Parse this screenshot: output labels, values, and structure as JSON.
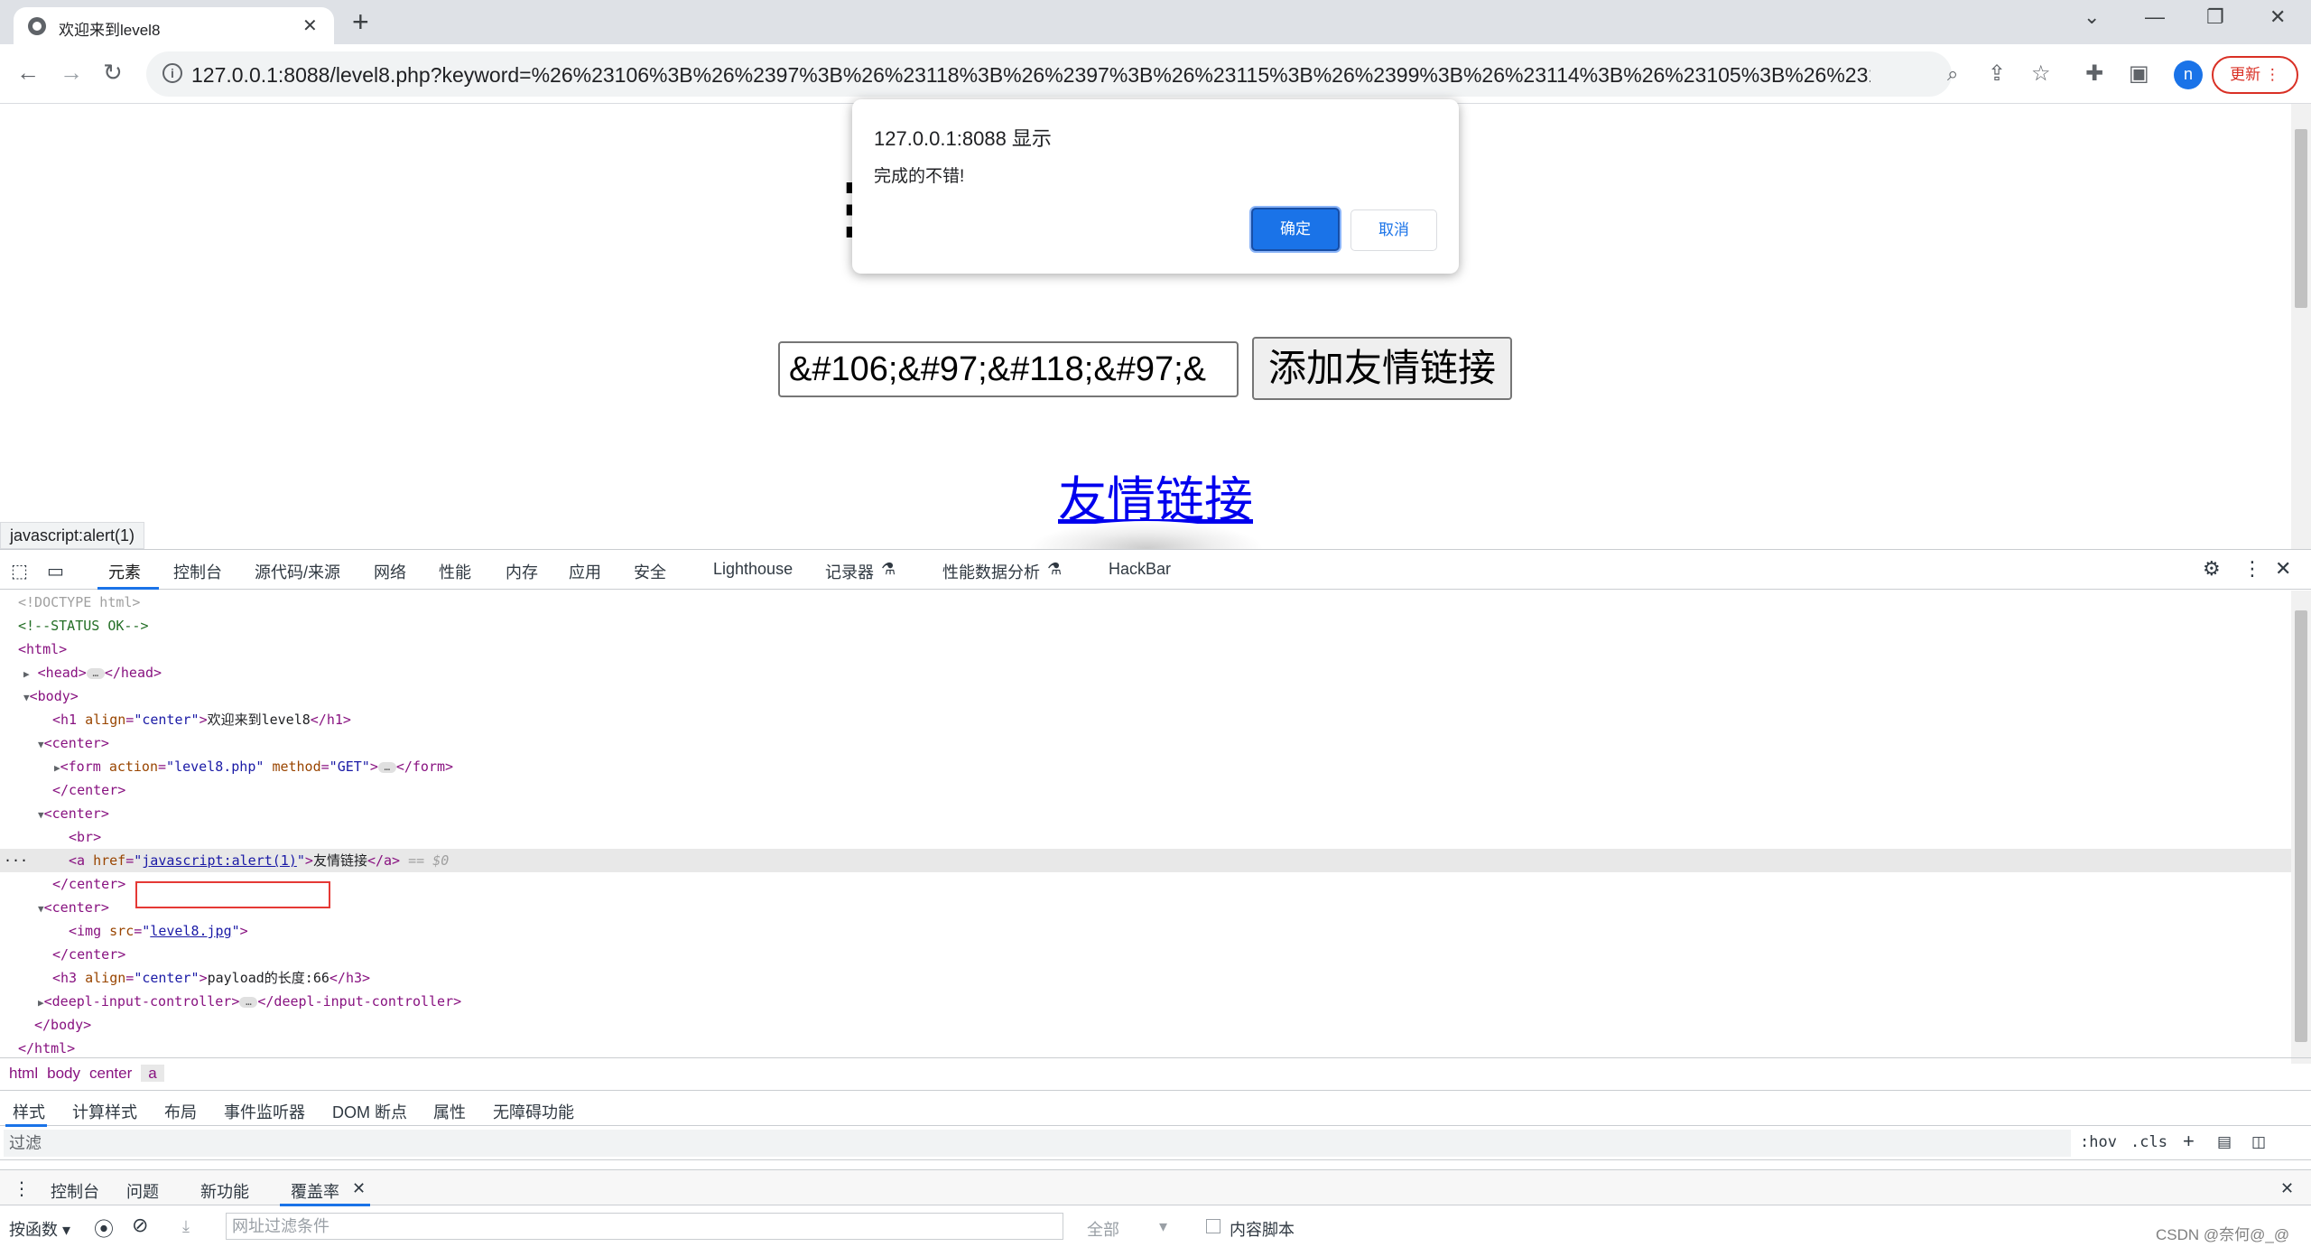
{
  "browser": {
    "tab_title": "欢迎来到level8",
    "url": "127.0.0.1:8088/level8.php?keyword=%26%23106%3B%26%2397%3B%26%23118%3B%26%2397%3B%26%23115%3B%26%2399%3B%26%23114%3B%26%23105%3B%26%23112%3B%26%...",
    "profile_initial": "n",
    "update_label": "更新",
    "icons": [
      "back-icon",
      "forward-icon",
      "reload-icon",
      "info-icon",
      "zoom-icon",
      "share-icon",
      "star-icon",
      "extensions-icon",
      "sidepanel-icon",
      "menu-icon"
    ]
  },
  "page": {
    "keyword_input_value": "&#106;&#97;&#118;&#97;&",
    "submit_label": "添加友情链接",
    "friend_link_text": "友情链接",
    "status_bar_url": "javascript:alert(1)"
  },
  "alert": {
    "origin": "127.0.0.1:8088 显示",
    "message": "完成的不错!",
    "ok_label": "确定",
    "cancel_label": "取消"
  },
  "devtools": {
    "tabs": [
      "元素",
      "控制台",
      "源代码/来源",
      "网络",
      "性能",
      "内存",
      "应用",
      "安全",
      "Lighthouse",
      "记录器",
      "性能数据分析",
      "HackBar"
    ],
    "active_tab": "元素",
    "dom": {
      "doctype": "<!DOCTYPE html>",
      "comment": "<!--STATUS OK-->",
      "h1_text": "欢迎来到level8",
      "form_action": "level8.php",
      "form_method": "GET",
      "a_href": "javascript:alert(1)",
      "a_text": "友情链接",
      "selected_marker": "== $0",
      "img_src": "level8.jpg",
      "h3_text": "payload的长度:66"
    },
    "breadcrumbs": [
      "html",
      "body",
      "center",
      "a"
    ],
    "styles_tabs": [
      "样式",
      "计算样式",
      "布局",
      "事件监听器",
      "DOM 断点",
      "属性",
      "无障碍功能"
    ],
    "filter_placeholder": "过滤",
    "hov_label": ":hov",
    "cls_label": ".cls",
    "drawer_tabs": [
      "控制台",
      "问题",
      "新功能",
      "覆盖率"
    ],
    "coverage": {
      "per_function_label": "按函数",
      "url_filter_placeholder": "网址过滤条件",
      "type_select": "全部",
      "content_scripts_label": "内容脚本"
    }
  },
  "watermark": "CSDN @奈何@_@"
}
